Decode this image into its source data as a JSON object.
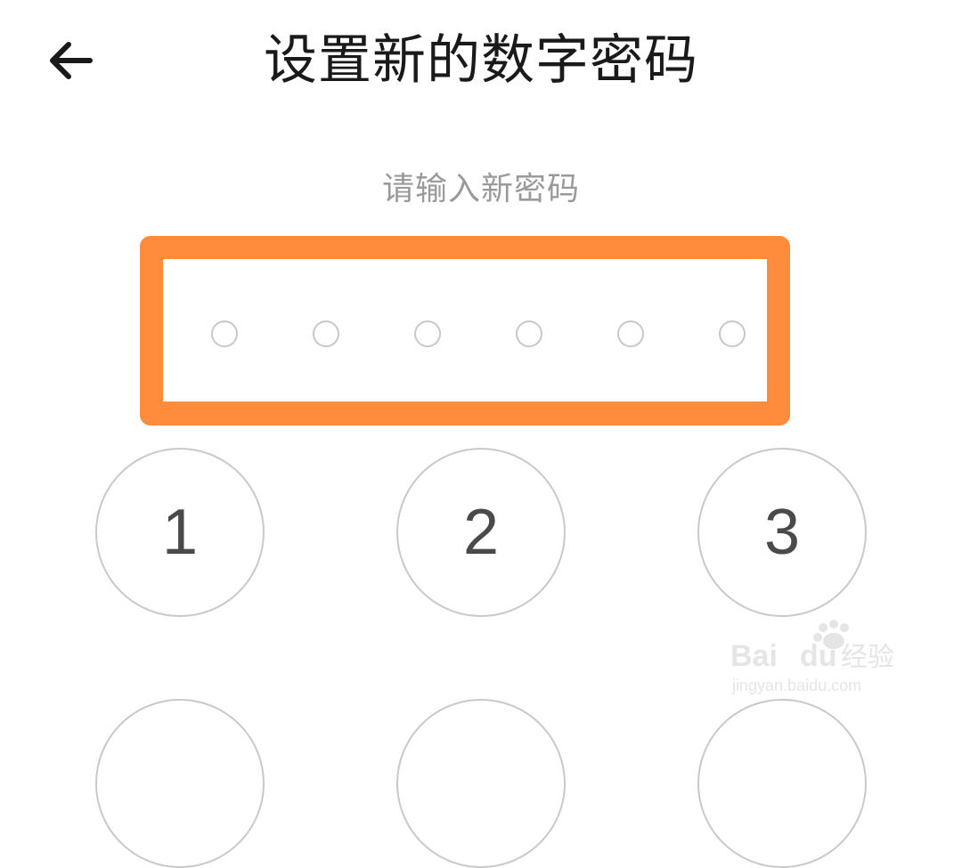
{
  "header": {
    "back_icon": "arrow-left-icon",
    "title": "设置新的数字密码"
  },
  "pin_entry": {
    "prompt": "请输入新密码",
    "length": 6,
    "filled": 0,
    "highlight_color": "#ff8b3d"
  },
  "keypad": {
    "keys": [
      {
        "label": "1"
      },
      {
        "label": "2"
      },
      {
        "label": "3"
      }
    ]
  },
  "watermark": {
    "logo": "baidu-jingyan-logo",
    "text": "Bai du 经验 jingyan.baidu.com"
  }
}
